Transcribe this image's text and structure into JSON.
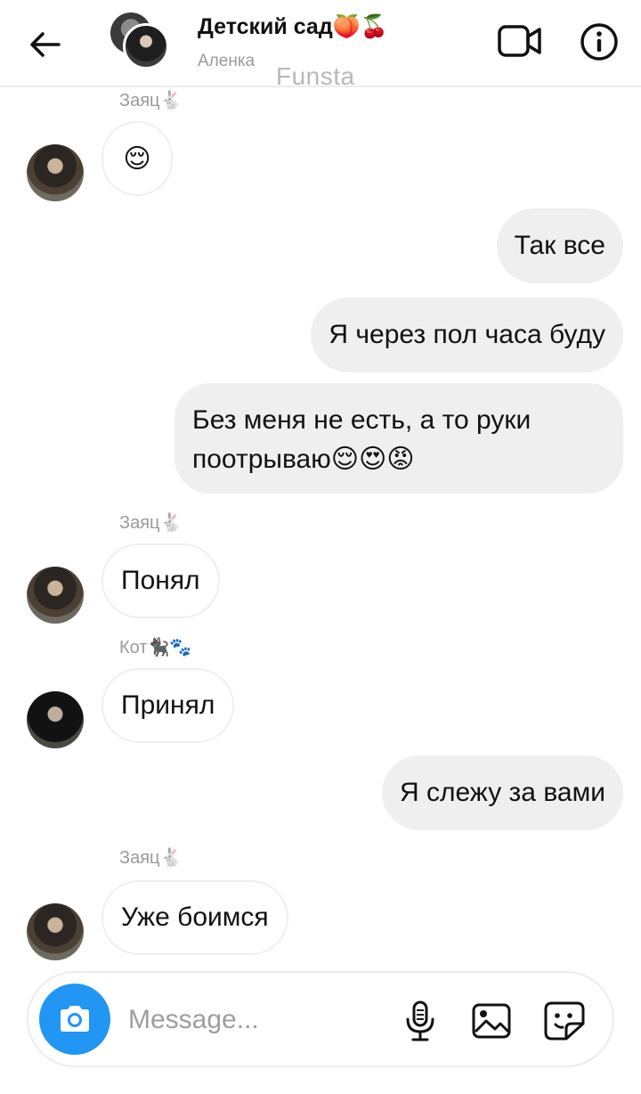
{
  "header": {
    "title": "Детский сад🍑🍒",
    "subtitle": "Аленка",
    "watermark": "Funsta"
  },
  "messages": [
    {
      "type": "in",
      "sender": "Заяц🐇",
      "text": "😌"
    },
    {
      "type": "out",
      "text": "Так все"
    },
    {
      "type": "out",
      "text": "Я через пол часа буду"
    },
    {
      "type": "out",
      "text": "Без меня не есть, а то руки поотрываю😌😍😡"
    },
    {
      "type": "in",
      "sender": "Заяц🐇",
      "text": "Понял"
    },
    {
      "type": "in",
      "sender": "Кот🐈‍⬛🐾",
      "text": "Принял"
    },
    {
      "type": "out",
      "text": "Я слежу за вами"
    },
    {
      "type": "in",
      "sender": "Заяц🐇",
      "text": "Уже боимся"
    }
  ],
  "composer": {
    "placeholder": "Message..."
  },
  "colors": {
    "accent": "#2196f3",
    "bubble_out": "#efefef",
    "muted_text": "#9a9a9a"
  }
}
